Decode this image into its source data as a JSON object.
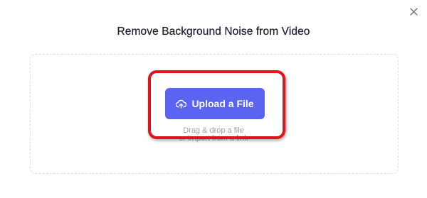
{
  "dialog": {
    "title": "Remove Background Noise from Video",
    "close_icon": "close-icon"
  },
  "dropzone": {
    "upload_button_label": "Upload a File",
    "upload_icon": "cloud-upload-icon",
    "hint_line1": "Drag & drop a file",
    "hint_line2": "or import from a link"
  },
  "annotation": {
    "highlight_color": "#e0141b"
  },
  "colors": {
    "accent": "#5b64f0"
  }
}
